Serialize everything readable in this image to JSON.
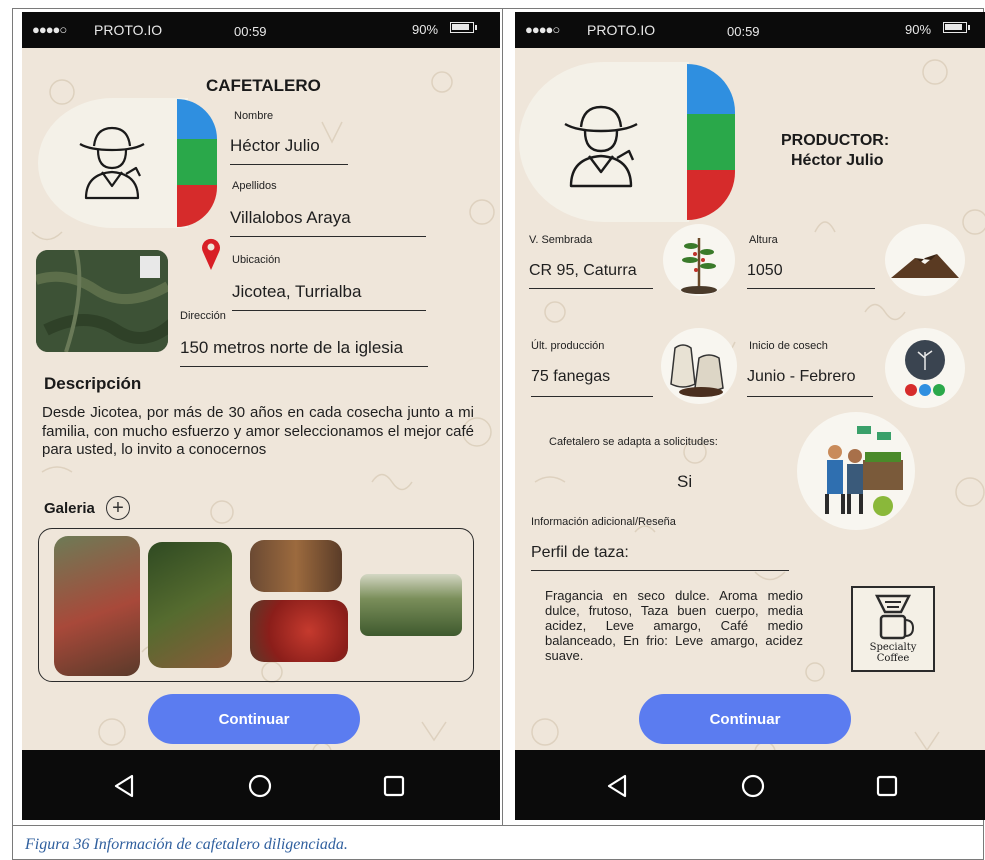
{
  "status_bar": {
    "carrier": "PROTO.IO",
    "time": "00:59",
    "battery": "90%"
  },
  "left_screen": {
    "title": "CAFETALERO",
    "nombre_label": "Nombre",
    "nombre_value": "Héctor Julio",
    "apellidos_label": "Apellidos",
    "apellidos_value": "Villalobos Araya",
    "ubicacion_label": "Ubicación",
    "ubicacion_value": "Jicotea, Turrialba",
    "direccion_label": "Dirección",
    "direccion_value": "150 metros norte de la iglesia",
    "descripcion_heading": "Descripción",
    "descripcion_text": "Desde Jicotea, por más de 30 años en cada cosecha junto a mi familia, con mucho esfuerzo y amor seleccionamos el mejor café para usted, lo invito a conocernos",
    "galeria_label": "Galeria",
    "continue_label": "Continuar"
  },
  "right_screen": {
    "productor_label": "PRODUCTOR:",
    "productor_name": "Héctor Julio",
    "variedad_label": "V. Sembrada",
    "variedad_value": "CR 95, Caturra",
    "altura_label": "Altura",
    "altura_value": "1050",
    "produccion_label": "Últ. producción",
    "produccion_value": "75 fanegas",
    "cosecha_label": "Inicio de cosech",
    "cosecha_value": "Junio - Febrero",
    "adapta_label": "Cafetalero se adapta a solicitudes:",
    "adapta_value": "Si",
    "info_label": "Información adicional/Reseña",
    "perfil_label": "Perfil de taza:",
    "perfil_text": "Fragancia en seco dulce. Aroma medio dulce, frutoso, Taza buen cuerpo, media acidez, Leve amargo, Café medio balanceado, En frio: Leve amargo, acidez suave.",
    "specialty_label": "Specialty Coffee",
    "continue_label": "Continuar"
  },
  "caption": "Figura 36 Información de cafetalero diligenciada.",
  "colors": {
    "background": "#efe6da",
    "button": "#5b7cf0",
    "wheel_blue": "#2f8fe0",
    "wheel_green": "#2aa84a",
    "wheel_red": "#d62b2b",
    "pin": "#d81f26",
    "caption": "#2f5f9e"
  },
  "icons": {
    "back": "back-triangle-icon",
    "home": "home-circle-icon",
    "recents": "recents-square-icon",
    "add": "plus-circle-icon",
    "location": "location-pin-icon"
  }
}
